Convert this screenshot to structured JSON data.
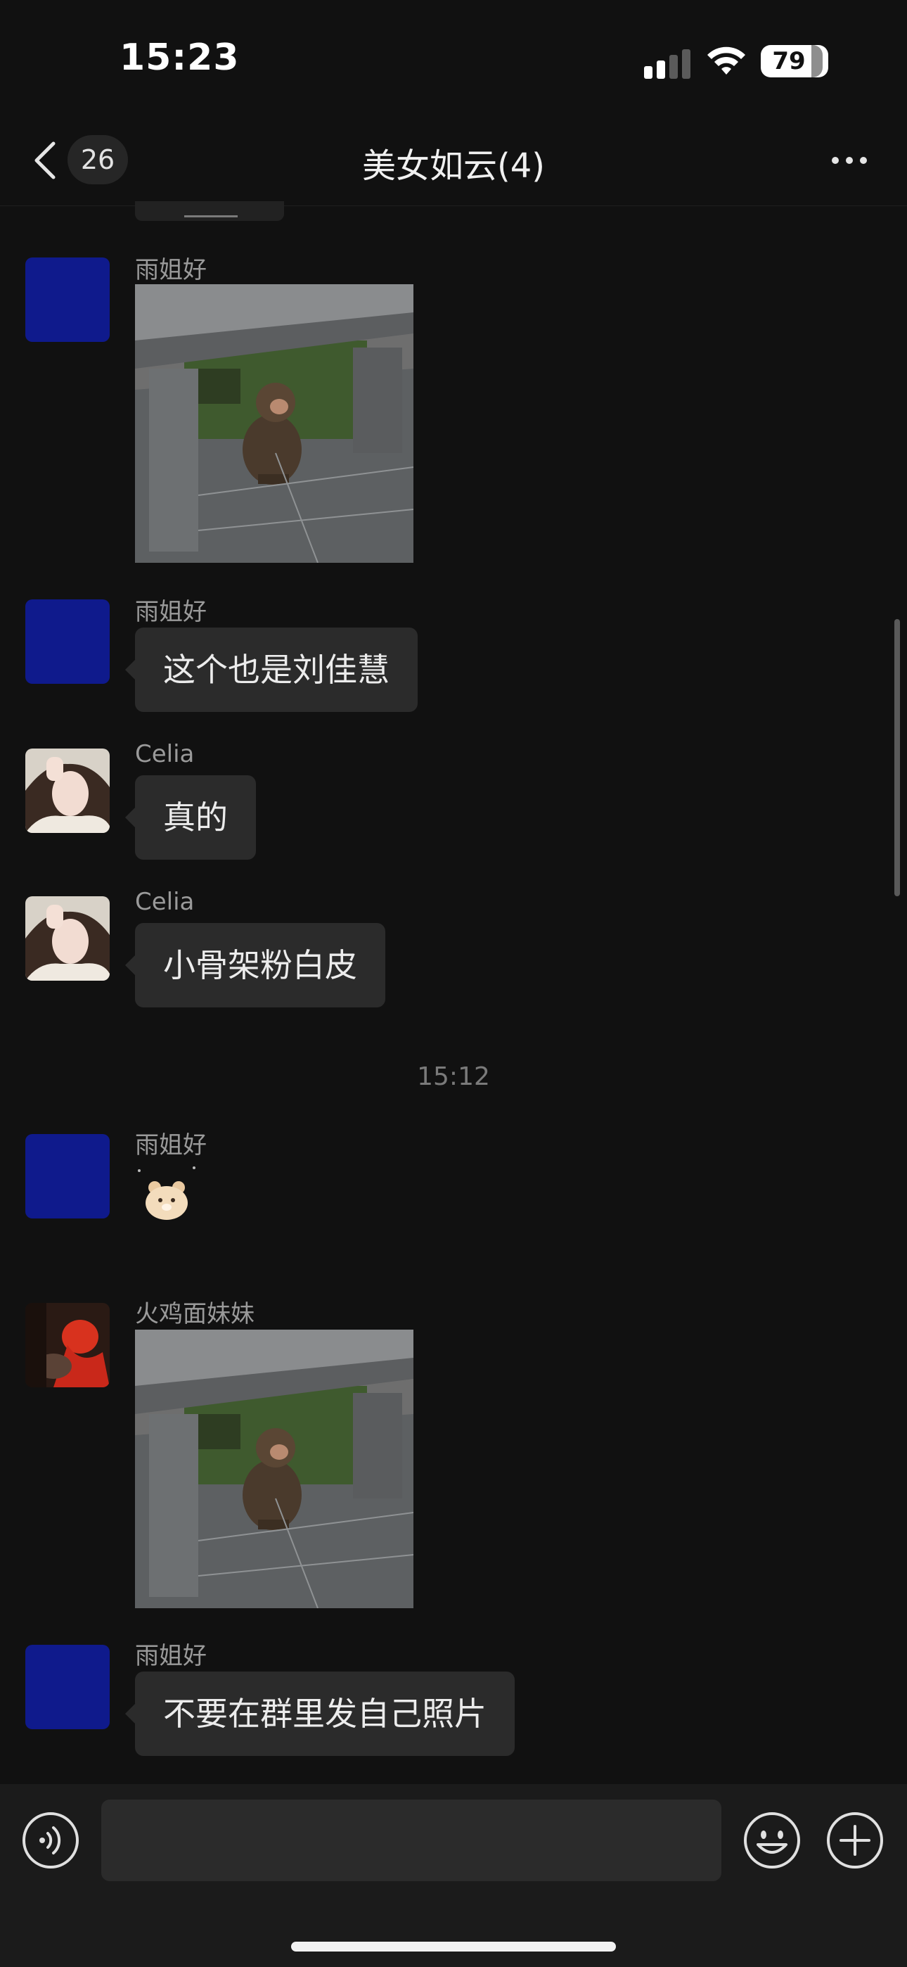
{
  "status_bar": {
    "time": "15:23",
    "battery": "79"
  },
  "nav": {
    "unread_count": "26",
    "title": "美女如云(4)"
  },
  "messages": [
    {
      "sender": "雨姐好",
      "type": "image",
      "content": "monkey-on-stone-bench photo"
    },
    {
      "sender": "雨姐好",
      "type": "text",
      "text": "这个也是刘佳慧"
    },
    {
      "sender": "Celia",
      "type": "text",
      "text": "真的"
    },
    {
      "sender": "Celia",
      "type": "text",
      "text": "小骨架粉白皮"
    },
    {
      "sender": "雨姐好",
      "type": "sticker",
      "content": "bear sticker"
    },
    {
      "sender": "火鸡面妹妹",
      "type": "image",
      "content": "monkey-on-stone-bench photo"
    },
    {
      "sender": "雨姐好",
      "type": "text",
      "text": "不要在群里发自己照片"
    }
  ],
  "timestamp": "15:12",
  "icons": {
    "back": "chevron-left-icon",
    "more": "more-dots-icon",
    "voice": "voice-icon",
    "emoji": "emoji-icon",
    "plus": "plus-icon"
  },
  "colors": {
    "background": "#111111",
    "bubble": "#2b2b2b",
    "avatar_blue": "#0f1a8c"
  }
}
